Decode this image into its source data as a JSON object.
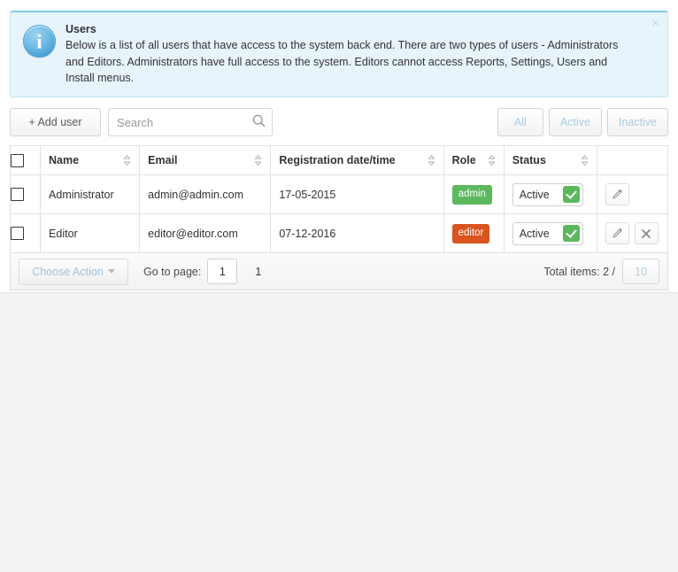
{
  "alert": {
    "icon": "info-circle-icon",
    "title": "Users",
    "body": "Below is a list of all users that have access to the system back end. There are two types of users - Administrators and Editors. Administrators have full access to the system. Editors cannot access Reports, Settings, Users and Install menus.",
    "close_label": "×"
  },
  "toolbar": {
    "add_user_label": "+ Add user",
    "search_placeholder": "Search",
    "search_value": "",
    "search_icon": "search-icon",
    "filters": [
      {
        "label": "All"
      },
      {
        "label": "Active"
      },
      {
        "label": "Inactive"
      }
    ]
  },
  "table": {
    "columns": [
      {
        "label": "",
        "sortable": false
      },
      {
        "label": "Name",
        "sortable": true
      },
      {
        "label": "Email",
        "sortable": true
      },
      {
        "label": "Registration date/time",
        "sortable": true
      },
      {
        "label": "Role",
        "sortable": true
      },
      {
        "label": "Status",
        "sortable": true
      },
      {
        "label": "",
        "sortable": false
      }
    ],
    "rows": [
      {
        "checked": false,
        "name": "Administrator",
        "email": "admin@admin.com",
        "registration": "17-05-2015",
        "role": "admin",
        "role_color": "#5cb85c",
        "status": "Active",
        "actions": [
          "edit"
        ]
      },
      {
        "checked": false,
        "name": "Editor",
        "email": "editor@editor.com",
        "registration": "07-12-2016",
        "role": "editor",
        "role_color": "#d9541e",
        "status": "Active",
        "actions": [
          "edit",
          "delete"
        ]
      }
    ]
  },
  "footer": {
    "choose_action_label": "Choose Action",
    "goto_label": "Go to page:",
    "goto_value": "1",
    "page_number": "1",
    "total_label": "Total items: 2 /",
    "per_page": "10"
  }
}
